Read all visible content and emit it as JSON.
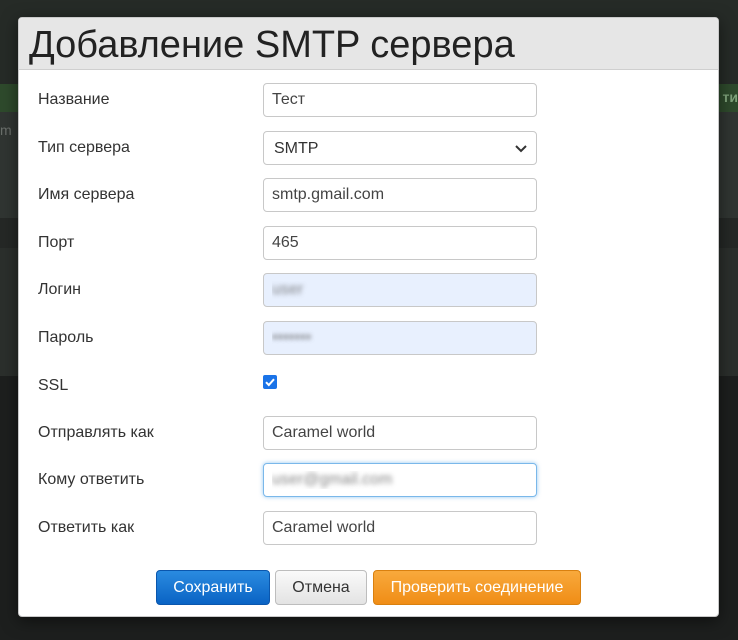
{
  "background": {
    "green_bar_text": "ти",
    "row_text": "m"
  },
  "modal": {
    "title": "Добавление SMTP сервера"
  },
  "form": {
    "name": {
      "label": "Название",
      "value": "Тест"
    },
    "server_type": {
      "label": "Тип сервера",
      "value": "SMTP"
    },
    "server_name": {
      "label": "Имя сервера",
      "value": "smtp.gmail.com"
    },
    "port": {
      "label": "Порт",
      "value": "465"
    },
    "login": {
      "label": "Логин",
      "value": "user"
    },
    "password": {
      "label": "Пароль",
      "value": "•••••••"
    },
    "ssl": {
      "label": "SSL",
      "checked": true
    },
    "send_as": {
      "label": "Отправлять как",
      "value": "Caramel world"
    },
    "reply_to": {
      "label": "Кому ответить",
      "value": "user@gmail.com"
    },
    "reply_as": {
      "label": "Ответить как",
      "value": "Caramel world"
    }
  },
  "buttons": {
    "save": "Сохранить",
    "cancel": "Отмена",
    "test_connection": "Проверить соединение"
  },
  "colors": {
    "primary": "#0a63c4",
    "warning": "#f08d16",
    "checkbox": "#1a73e8",
    "autofill": "#e8f0fe"
  },
  "icons": {
    "select_arrow": "chevron-down-icon",
    "ssl_check": "checkmark-icon"
  }
}
